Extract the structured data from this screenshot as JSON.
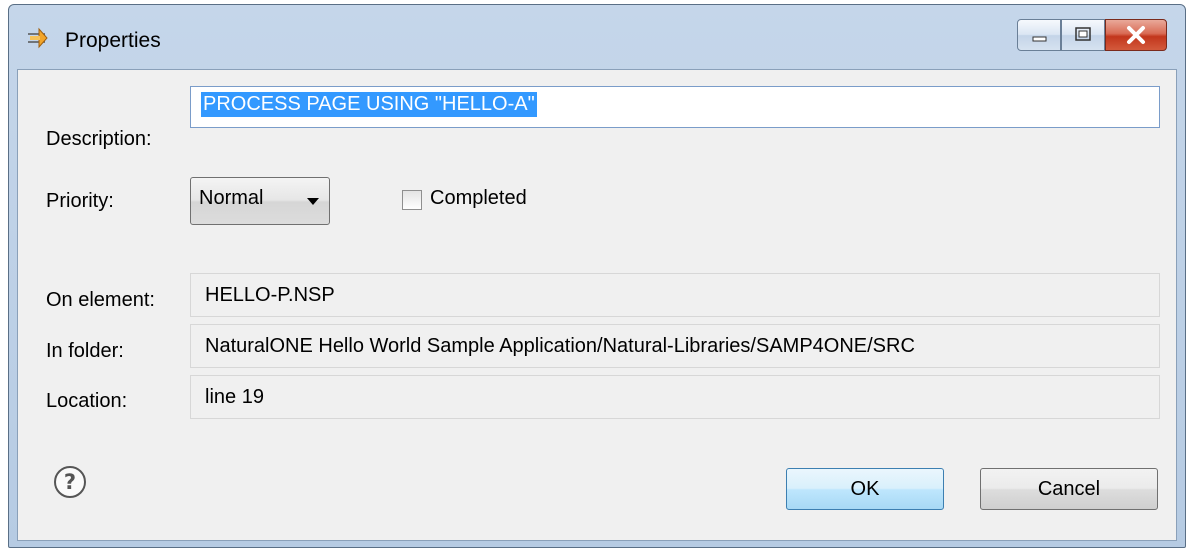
{
  "window": {
    "title": "Properties",
    "icon": "task-properties-icon",
    "controls": [
      "minimize-icon",
      "maximize-icon",
      "close-icon"
    ]
  },
  "form": {
    "description_label": "Description:",
    "description_value": "PROCESS PAGE USING \"HELLO-A\"",
    "priority_label": "Priority:",
    "priority_value": "Normal",
    "completed_label": "Completed",
    "completed_checked": false,
    "on_element_label": "On element:",
    "on_element_value": "HELLO-P.NSP",
    "in_folder_label": "In folder:",
    "in_folder_value": "NaturalONE Hello World Sample Application/Natural-Libraries/SAMP4ONE/SRC",
    "location_label": "Location:",
    "location_value": "line 19"
  },
  "buttons": {
    "help_icon": "help-icon",
    "ok_label": "OK",
    "cancel_label": "Cancel"
  },
  "colors": {
    "selection": "#3399ff",
    "titlebar": "#c5d6ea",
    "close": "#c2361c"
  }
}
